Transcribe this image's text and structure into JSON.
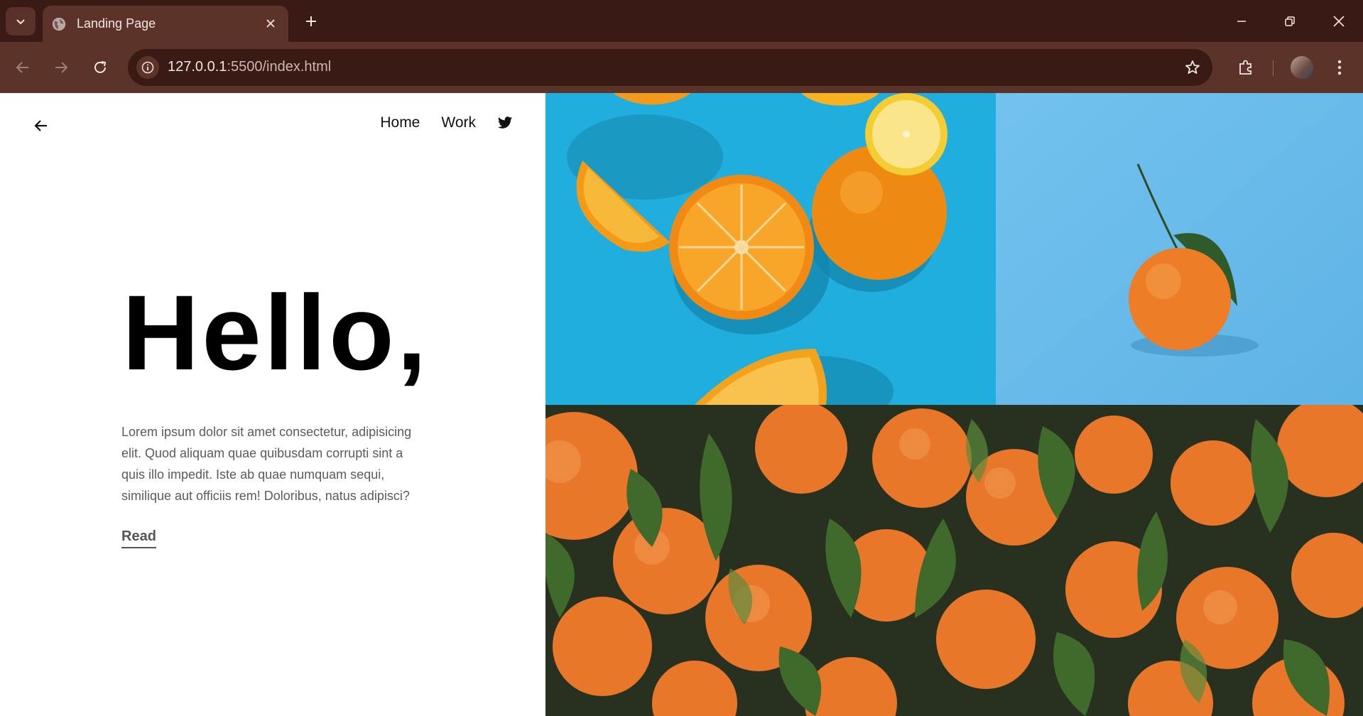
{
  "browser": {
    "tab_title": "Landing Page",
    "url_host": "127.0.0.1",
    "url_rest": ":5500/index.html"
  },
  "page": {
    "nav": {
      "home_label": "Home",
      "work_label": "Work"
    },
    "heading": "Hello,",
    "body_text": "Lorem ipsum dolor sit amet consectetur, adipisicing elit. Quod aliquam quae quibusdam corrupti sint a quis illo impedit. Iste ab quae numquam sequi, similique aut officiis rem! Doloribus, natus adipisci?",
    "read_label": "Read"
  },
  "colors": {
    "chrome_dark": "#3a1a14",
    "chrome_mid": "#5c3329",
    "orange": "#f08a24",
    "sky_blue": "#1fb0dc"
  }
}
